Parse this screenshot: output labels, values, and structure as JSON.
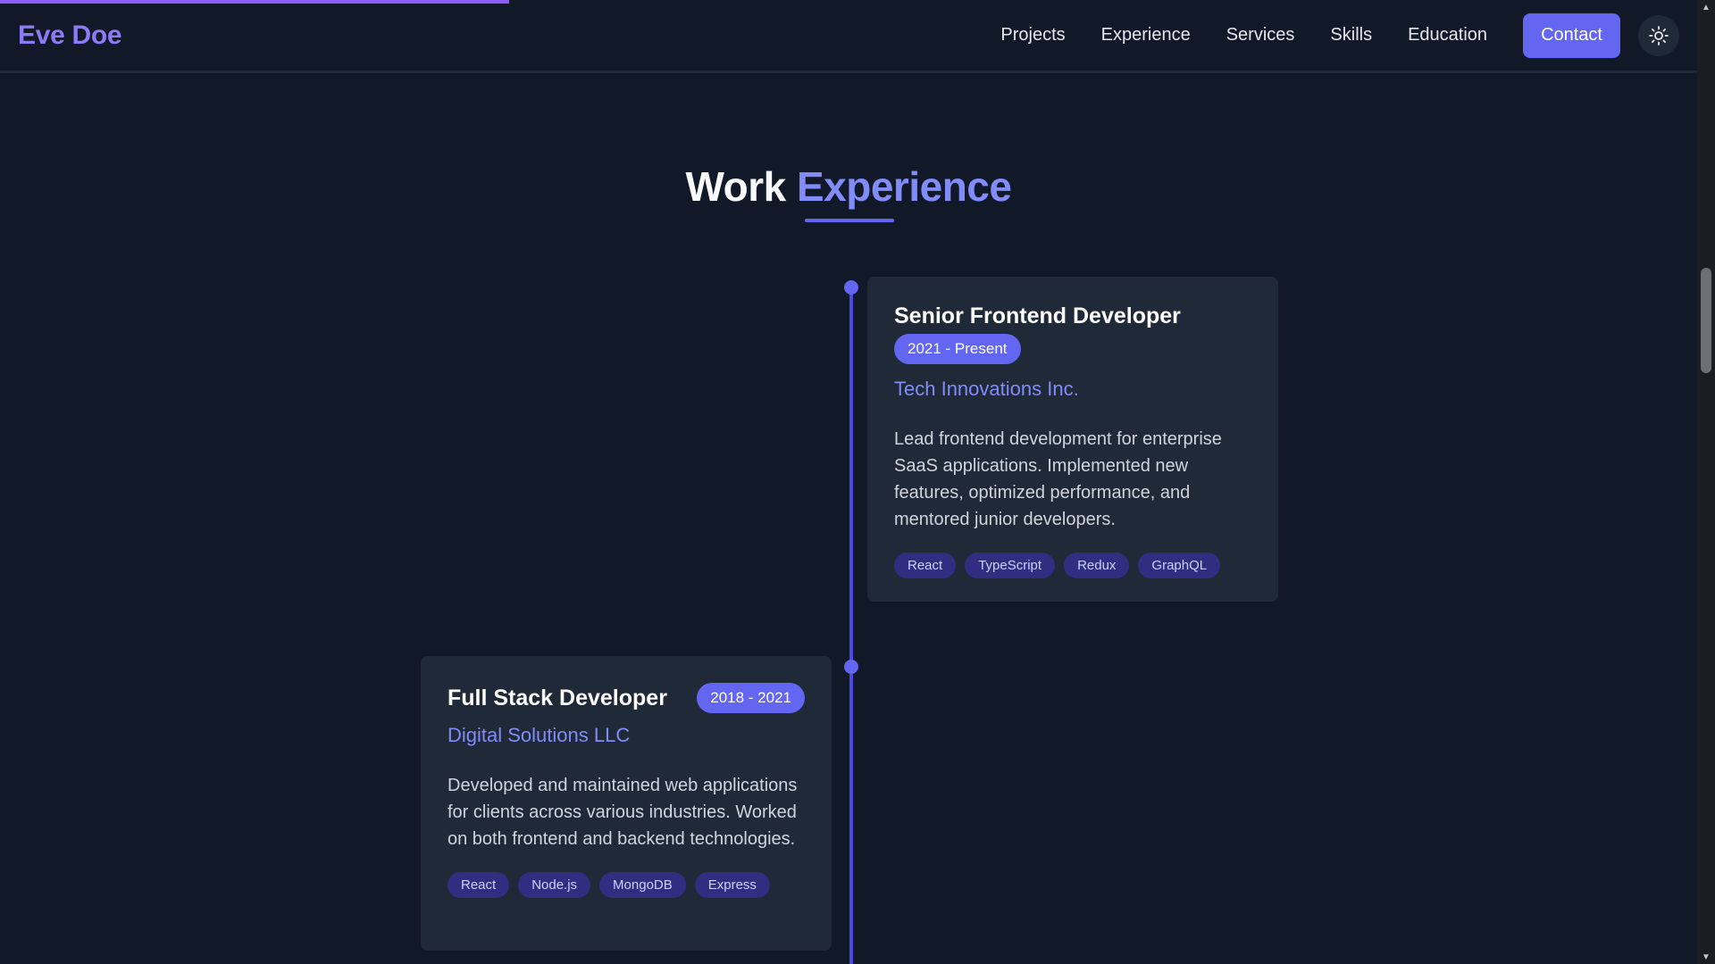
{
  "header": {
    "logo": "Eve Doe",
    "nav": [
      "Projects",
      "Experience",
      "Services",
      "Skills",
      "Education"
    ],
    "contact_label": "Contact",
    "theme_toggle_icon": "sun-icon"
  },
  "scroll_progress": 0.3,
  "section": {
    "title_main": "Work",
    "title_accent": "Experience"
  },
  "experience": [
    {
      "title": "Senior Frontend Developer",
      "dates": "2021 - Present",
      "company": "Tech Innovations Inc.",
      "description": "Lead frontend development for enterprise SaaS applications. Implemented new features, optimized performance, and mentored junior developers.",
      "tags": [
        "React",
        "TypeScript",
        "Redux",
        "GraphQL"
      ]
    },
    {
      "title": "Full Stack Developer",
      "dates": "2018 - 2021",
      "company": "Digital Solutions LLC",
      "description": "Developed and maintained web applications for clients across various industries. Worked on both frontend and backend technologies.",
      "tags": [
        "React",
        "Node.js",
        "MongoDB",
        "Express"
      ]
    }
  ],
  "colors": {
    "background": "#111827",
    "card": "#1f2937",
    "accent": "#6366f1",
    "accent_text": "#818cf8",
    "progress": "#8b5cf6"
  }
}
